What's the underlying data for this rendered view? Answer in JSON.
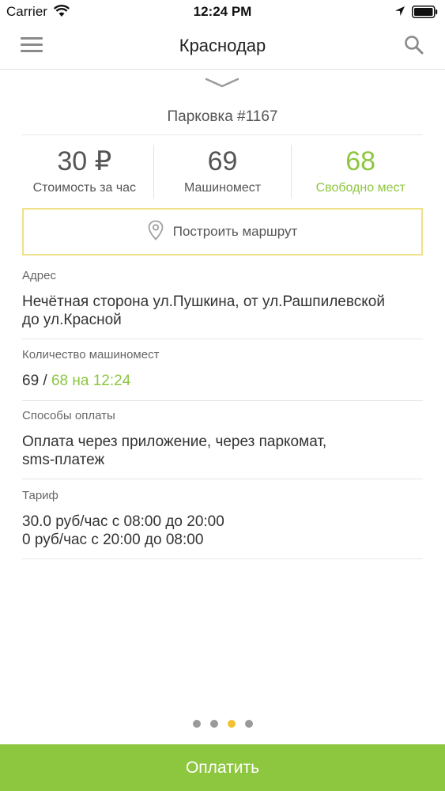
{
  "status_bar": {
    "carrier": "Carrier",
    "time": "12:24 PM"
  },
  "nav": {
    "title": "Краснодар"
  },
  "parking": {
    "title": "Парковка #1167"
  },
  "stats": [
    {
      "value": "30 ₽",
      "label": "Стоимость за час"
    },
    {
      "value": "69",
      "label": "Машиномест"
    },
    {
      "value": "68",
      "label": "Свободно мест"
    }
  ],
  "route": {
    "label": "Построить маршрут"
  },
  "address": {
    "label": "Адрес",
    "line1": "Нечётная сторона ул.Пушкина, от ул.Рашпилевской",
    "line2": "до ул.Красной"
  },
  "spaces": {
    "label": "Количество машиномест",
    "total": "69",
    "divider": " / ",
    "free": "68 на 12:24"
  },
  "payment": {
    "label": "Способы оплаты",
    "line1": "Оплата через приложение, через паркомат,",
    "line2": "sms-платеж"
  },
  "tariff": {
    "label": "Тариф",
    "line1": "30.0 руб/час с 08:00 до 20:00",
    "line2": "0 руб/час с 20:00 до 08:00"
  },
  "pager": {
    "count": 4,
    "active_index": 2
  },
  "pay_button": {
    "label": "Оплатить"
  },
  "colors": {
    "accent_green": "#8dc63f",
    "route_border": "#efe08a",
    "pager_active": "#f2c232"
  }
}
